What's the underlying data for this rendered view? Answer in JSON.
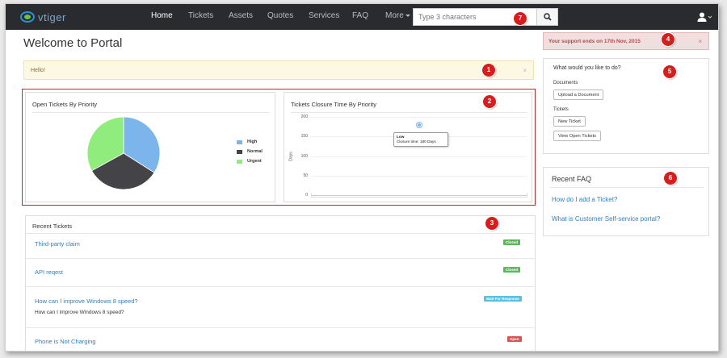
{
  "nav": {
    "logo_text": "vtiger",
    "items": [
      {
        "label": "Home",
        "active": true
      },
      {
        "label": "Tickets",
        "active": false
      },
      {
        "label": "Assets",
        "active": false
      },
      {
        "label": "Quotes",
        "active": false
      },
      {
        "label": "Services",
        "active": false
      },
      {
        "label": "FAQ",
        "active": false
      },
      {
        "label": "More",
        "active": false
      }
    ],
    "search_placeholder": "Type 3 characters",
    "search_icon": "search-icon",
    "user_icon": "user-icon"
  },
  "page_title": "Welcome to Portal",
  "hello_alert": {
    "text": "Hello!",
    "close": "×"
  },
  "support_alert": {
    "text": "Your support ends on 17th Nov, 2015",
    "close": "×"
  },
  "open_tickets_chart": {
    "title": "Open Tickets By Priority",
    "chart_data": {
      "type": "pie",
      "labels": [
        "High",
        "Normal",
        "Urgent"
      ],
      "values": [
        34,
        33,
        33
      ],
      "colors": [
        "#7cb5ec",
        "#434348",
        "#90ed7d"
      ],
      "legend": "right"
    }
  },
  "closure_chart": {
    "title": "Tickets Closure Time By Priority",
    "ylabel": "Days",
    "yticks": [
      "200",
      "150",
      "100",
      "50",
      "0"
    ],
    "chart_data": {
      "type": "scatter",
      "categories": [
        "Low"
      ],
      "values": [
        180
      ],
      "ylabel": "Days",
      "ylim": [
        0,
        200
      ]
    },
    "tooltip": {
      "title": "Low",
      "text": "Closure time: 180 Days"
    }
  },
  "recent_tickets": {
    "title": "Recent Tickets",
    "items": [
      {
        "title": "Third-party claim",
        "desc": "",
        "status": "Closed"
      },
      {
        "title": "API reqest",
        "desc": "",
        "status": "Closed"
      },
      {
        "title": "How can I improve Windows 8 speed?",
        "desc": "How can I improve Windows 8 speed?",
        "status": "Wait For Response"
      },
      {
        "title": "Phone is Not Charging",
        "desc": "",
        "status": "Open"
      }
    ]
  },
  "actions": {
    "title": "What would you like to do?",
    "documents_label": "Documents",
    "upload_button": "Upload a Document",
    "tickets_label": "Tickets",
    "new_ticket_button": "New Ticket",
    "view_open_button": "View Open Tickets"
  },
  "recent_faq": {
    "title": "Recent FAQ",
    "items": [
      "How do I add a Ticket?",
      "What is Customer Self-service portal?"
    ]
  },
  "callouts": [
    "1",
    "2",
    "3",
    "4",
    "5",
    "6",
    "7"
  ]
}
